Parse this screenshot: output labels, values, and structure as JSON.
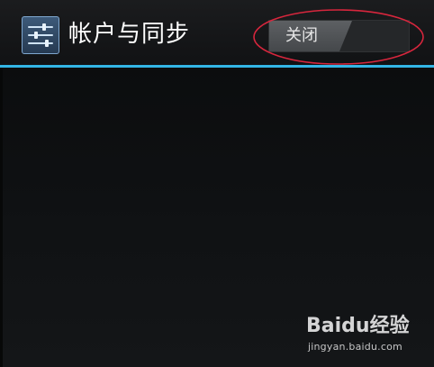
{
  "action_bar": {
    "title": "帐户与同步",
    "app_icon": "settings-sliders-icon",
    "sync_toggle": {
      "label": "关闭",
      "state": "off"
    }
  },
  "annotation": {
    "shape": "ellipse",
    "color": "#d7263d",
    "target": "sync_toggle"
  },
  "watermark": {
    "brand": "Baidu经验",
    "url": "jingyan.baidu.com"
  },
  "colors": {
    "accent": "#33b5e5",
    "background": "#0b0c0d"
  }
}
